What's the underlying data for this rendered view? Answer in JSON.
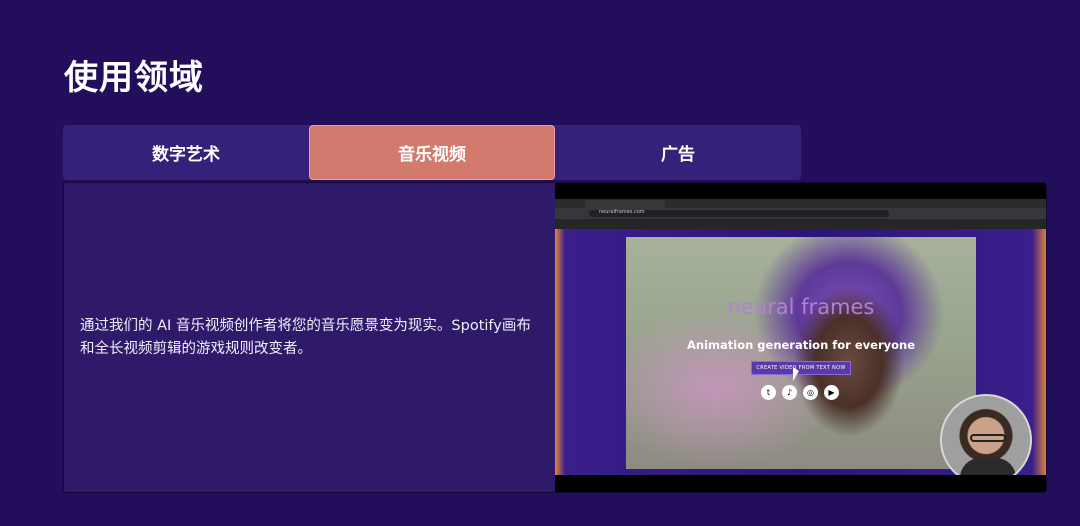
{
  "section": {
    "title": "使用领域"
  },
  "tabs": [
    {
      "label": "数字艺术",
      "active": false
    },
    {
      "label": "音乐视频",
      "active": true
    },
    {
      "label": "广告",
      "active": false
    }
  ],
  "panel": {
    "description": "通过我们的 AI 音乐视频创作者将您的音乐愿景变为现实。Spotify画布和全长视频剪辑的游戏规则改变者。"
  },
  "video": {
    "browser_url": "neuralframes.com",
    "brand": "neural frames",
    "tagline": "Animation generation for everyone",
    "cta_label": "CREATE VIDEO FROM TEXT NOW",
    "social_icons": [
      "twitter-icon",
      "tiktok-icon",
      "instagram-icon",
      "youtube-icon"
    ]
  },
  "colors": {
    "background": "#230e5c",
    "tab_bar": "#35207a",
    "active_tab": "#d27a6e",
    "panel": "#2f1a69"
  }
}
